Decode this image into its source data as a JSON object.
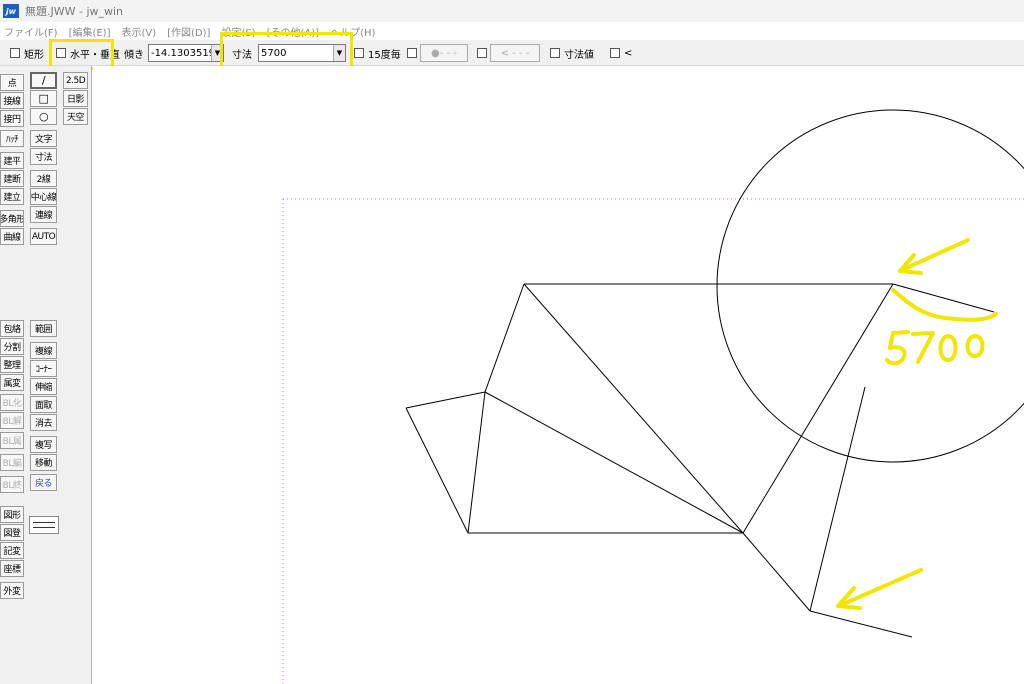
{
  "window": {
    "icon_text": "jw",
    "title": "無題.JWW - jw_win"
  },
  "menu": [
    "ファイル(F)",
    "[編集(E)]",
    "表示(V)",
    "[作図(D)]",
    "設定(S)",
    "[その他(A)]",
    "ヘルプ(H)"
  ],
  "toolbar": {
    "rect_label": "矩形",
    "hv_label": "水平・垂直",
    "angle_label": "傾き",
    "angle_value": "-14.1303519",
    "dim_label": "寸法",
    "dim_value": "5700",
    "deg15_label": "15度毎",
    "btn_dot": "●- - -",
    "btn_arrow": "< - - -",
    "dimval_label": "寸法値",
    "lt_label": "<"
  },
  "toolbox": {
    "col1_top": [
      "点",
      "接線",
      "接円",
      "ﾊｯﾁ",
      "建平",
      "建断",
      "建立",
      "多角形",
      "曲線"
    ],
    "col2_top": [
      "/",
      "□",
      "○",
      "文字",
      "寸法",
      "2線",
      "中心線",
      "連線",
      "AUTO"
    ],
    "col3_top": [
      "2.5D",
      "日影",
      "天空"
    ],
    "col1_mid": [
      "包絡",
      "分割",
      "整理",
      "属変",
      "BL化",
      "BL解",
      "BL属",
      "BL編",
      "BL終"
    ],
    "col2_mid": [
      "範囲",
      "複線",
      "ｺｰﾅｰ",
      "伸縮",
      "面取",
      "消去",
      "複写",
      "移動",
      "戻る"
    ],
    "col1_bot": [
      "図形",
      "図登",
      "記変",
      "座標",
      "外変"
    ]
  },
  "annotations": {
    "handwritten_value": "5700",
    "highlight_color": "#f2e600",
    "accent_color": "#1f5fbf"
  }
}
